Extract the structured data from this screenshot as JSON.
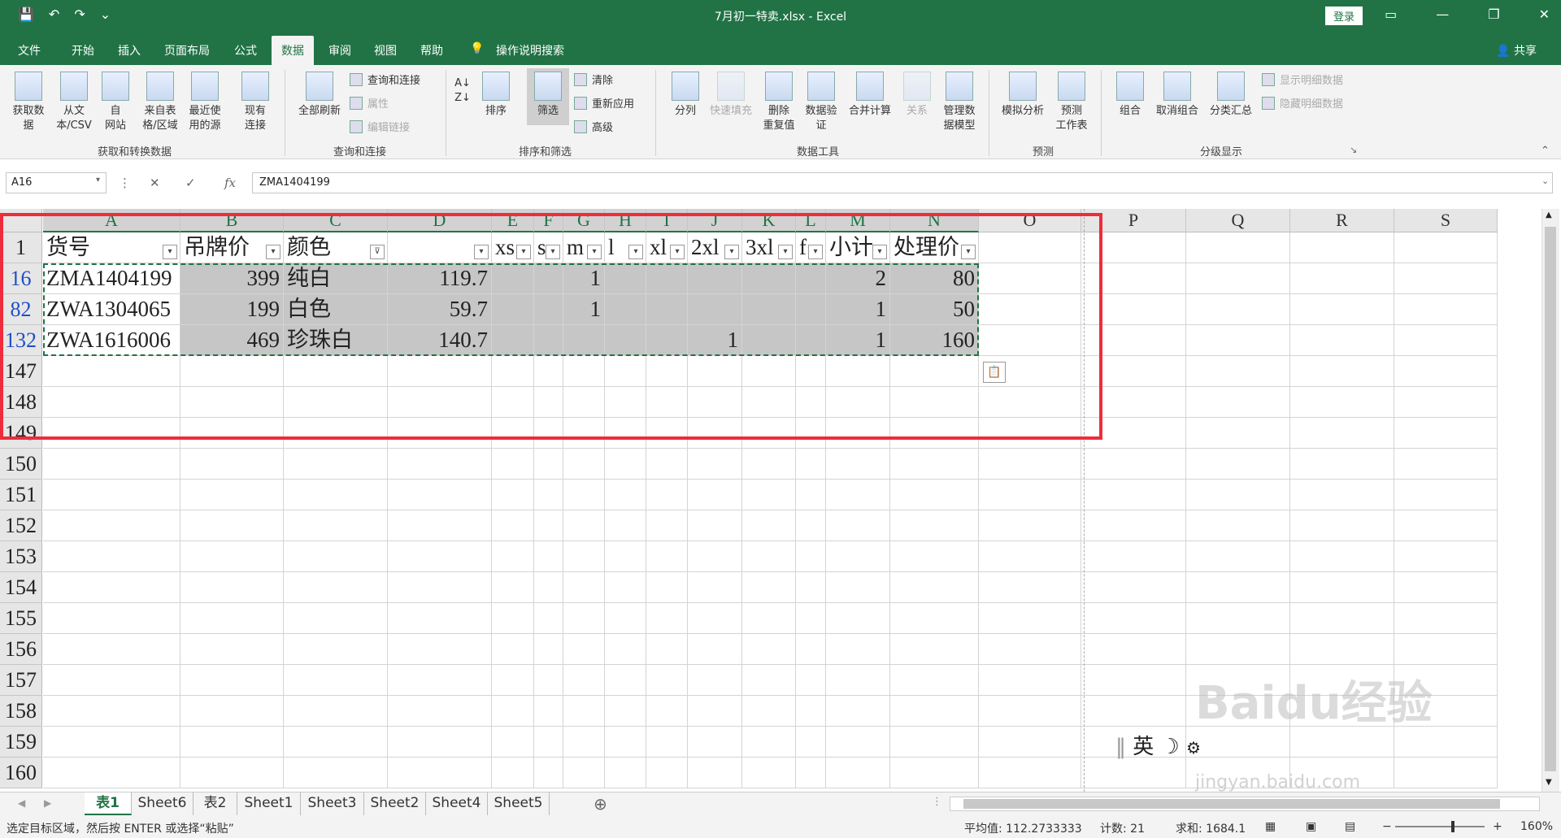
{
  "window": {
    "title": "7月初一特卖.xlsx  -  Excel",
    "login": "登录",
    "share": "共享"
  },
  "menu": [
    "文件",
    "开始",
    "插入",
    "页面布局",
    "公式",
    "数据",
    "审阅",
    "视图",
    "帮助",
    "操作说明搜索"
  ],
  "ribbon": {
    "get_data": [
      "获取数",
      "据",
      "从文",
      "本/CSV",
      "自",
      "网站",
      "来自表",
      "格/区域",
      "最近使",
      "用的源",
      "现有",
      "连接"
    ],
    "refresh_all": "全部刷新",
    "queries": [
      "查询和连接",
      "属性",
      "编辑链接"
    ],
    "sort": "排序",
    "filter": "筛选",
    "filter_opts": [
      "清除",
      "重新应用",
      "高级"
    ],
    "tools": [
      "分列",
      "快速填充",
      "删除",
      "重复值",
      "数据验",
      "证",
      "合并计算",
      "关系",
      "管理数",
      "据模型"
    ],
    "forecast": [
      "模拟分析",
      "预测",
      "工作表"
    ],
    "outline": [
      "组合",
      "取消组合",
      "分类汇总",
      "显示明细数据",
      "隐藏明细数据"
    ],
    "groups": [
      "获取和转换数据",
      "查询和连接",
      "排序和筛选",
      "数据工具",
      "预测",
      "分级显示"
    ]
  },
  "formula_bar": {
    "name_box": "A16",
    "fx": "fx",
    "value": "ZMA1404199"
  },
  "columns": [
    "A",
    "B",
    "C",
    "D",
    "E",
    "F",
    "G",
    "H",
    "I",
    "J",
    "K",
    "L",
    "M",
    "N",
    "O",
    "P",
    "Q",
    "R",
    "S"
  ],
  "header_row": {
    "num": "1",
    "cells": [
      "货号",
      "吊牌价",
      "颜色",
      "",
      "xs",
      "s",
      "m",
      "l",
      "xl",
      "2xl",
      "3xl",
      "f",
      "小计",
      "处理价"
    ]
  },
  "rows": [
    {
      "num": "16",
      "cells": [
        "ZMA1404199",
        "399",
        "纯白",
        "119.7",
        "",
        "",
        "1",
        "",
        "",
        "",
        "",
        "",
        "2",
        "80"
      ]
    },
    {
      "num": "82",
      "cells": [
        "ZWA1304065",
        "199",
        "白色",
        "59.7",
        "",
        "",
        "1",
        "",
        "",
        "",
        "",
        "",
        "1",
        "50"
      ]
    },
    {
      "num": "132",
      "cells": [
        "ZWA1616006",
        "469",
        "珍珠白",
        "140.7",
        "",
        "",
        "",
        "",
        "",
        "1",
        "",
        "",
        "1",
        "160"
      ]
    }
  ],
  "empty_rows": [
    "147",
    "148",
    "149",
    "150",
    "151",
    "152",
    "153",
    "154",
    "155",
    "156",
    "157",
    "158",
    "159",
    "160"
  ],
  "sheets": [
    "表1",
    "Sheet6",
    "表2",
    "Sheet1",
    "Sheet3",
    "Sheet2",
    "Sheet4",
    "Sheet5"
  ],
  "status": {
    "message": "选定目标区域，然后按 ENTER 或选择“粘贴”",
    "average": "平均值: 112.2733333",
    "count": "计数: 21",
    "sum": "求和: 1684.1",
    "zoom": "160%"
  },
  "ime": "英",
  "watermark": "Baidu经验",
  "watermark_url": "jingyan.baidu.com"
}
